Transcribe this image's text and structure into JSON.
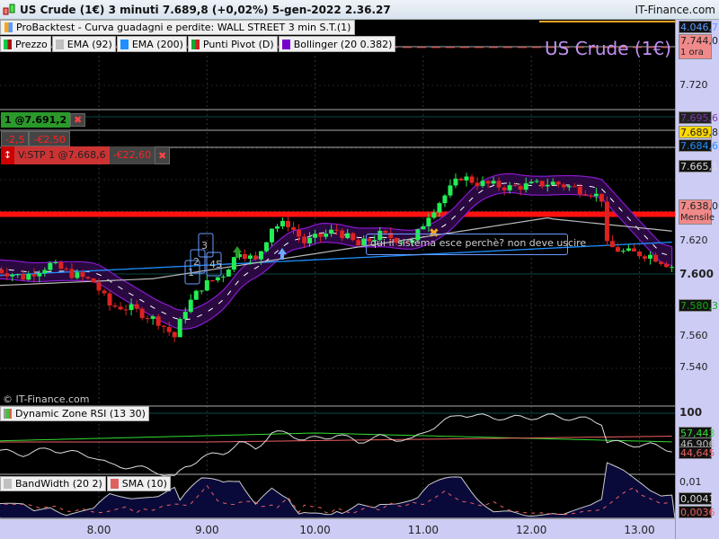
{
  "window": {
    "title": "US Crude (1€) 3 minuti 7.689,8 (+0,02%) 5-gen-2022 2.36.27",
    "site": "IT-Finance.com"
  },
  "backtest": {
    "label": "ProBacktest - Curva guadagni e perdite: WALL STREET 3 min S.T.(1)",
    "value": "4.046,7"
  },
  "legend": [
    {
      "label": "Prezzo",
      "colors": [
        "#11cc44",
        "#aa1111"
      ]
    },
    {
      "label": "EMA (92)",
      "colors": [
        "#c0c0c0"
      ]
    },
    {
      "label": "EMA (200)",
      "colors": [
        "#1e90ff"
      ]
    },
    {
      "label": "Punti Pivot (D)",
      "colors": [
        "#11aa33",
        "#cc2222"
      ]
    },
    {
      "label": "Bollinger (20 0.382)",
      "colors": [
        "#7700cc"
      ]
    }
  ],
  "watermark": "US Crude (1€)",
  "copyright": "© IT-Finance.com",
  "orders": {
    "position": "1 @7.691,2",
    "points": "-2,5",
    "pnl": "-€2,50",
    "stop": "V:STP 1 @7.668,6",
    "stop_pnl": "-€22,60"
  },
  "annotation": "qui il sistema esce perchè? non deve uscire",
  "trade_labels": [
    "1",
    "2",
    "3",
    "45"
  ],
  "price_scale": {
    "ticks": [
      "7.720",
      "7.620",
      "7.600",
      "7.580",
      "7.560",
      "7.540"
    ],
    "labels": [
      {
        "text": "7.744,0",
        "sub": "1 ora",
        "bg": "#f08a8a",
        "color": "#222"
      },
      {
        "text": "7.695,6",
        "bg": "#222",
        "color": "#7a3aaa"
      },
      {
        "text": "7.689,8",
        "bg": "#ffd800",
        "color": "#222"
      },
      {
        "text": "7.684,6",
        "bg": "#111",
        "color": "#1e90ff"
      },
      {
        "text": "7.665,1",
        "bg": "#111",
        "color": "#ddd"
      },
      {
        "text": "7.638,0",
        "sub": "Mensile",
        "bg": "#f08a8a",
        "color": "#222"
      },
      {
        "text": "7.580,3",
        "bg": "#111",
        "color": "#11aa11"
      }
    ]
  },
  "price_path": [
    [
      7.05,
      7.603
    ],
    [
      7.3,
      7.598
    ],
    [
      7.55,
      7.606
    ],
    [
      7.75,
      7.6
    ],
    [
      7.95,
      7.595
    ],
    [
      8.1,
      7.58
    ],
    [
      8.3,
      7.578
    ],
    [
      8.55,
      7.57
    ],
    [
      8.7,
      7.56
    ],
    [
      8.8,
      7.578
    ],
    [
      8.95,
      7.592
    ],
    [
      9.15,
      7.6
    ],
    [
      9.3,
      7.615
    ],
    [
      9.45,
      7.608
    ],
    [
      9.6,
      7.63
    ],
    [
      9.75,
      7.632
    ],
    [
      9.9,
      7.62
    ],
    [
      10.2,
      7.628
    ],
    [
      10.4,
      7.618
    ],
    [
      10.6,
      7.625
    ],
    [
      10.9,
      7.62
    ],
    [
      11.05,
      7.638
    ],
    [
      11.2,
      7.65
    ],
    [
      11.35,
      7.662
    ],
    [
      11.5,
      7.658
    ],
    [
      11.8,
      7.655
    ],
    [
      12.2,
      7.658
    ],
    [
      12.55,
      7.652
    ],
    [
      12.65,
      7.648
    ],
    [
      12.7,
      7.618
    ],
    [
      12.85,
      7.614
    ],
    [
      13.1,
      7.612
    ],
    [
      13.3,
      7.605
    ]
  ],
  "rsi": {
    "label": "Dynamic Zone RSI (13 30)",
    "ticks": [
      "100"
    ],
    "values": [
      "57,443",
      "46,906",
      "44,645"
    ]
  },
  "bandwidth": {
    "label": "BandWidth (20 2)",
    "sma_label": "SMA (10)",
    "ticks": [
      "0,01"
    ],
    "values": [
      "0,0041",
      "0,0036"
    ]
  },
  "time_axis": [
    "8.00",
    "9.00",
    "10.00",
    "11.00",
    "12.00",
    "13.00"
  ]
}
